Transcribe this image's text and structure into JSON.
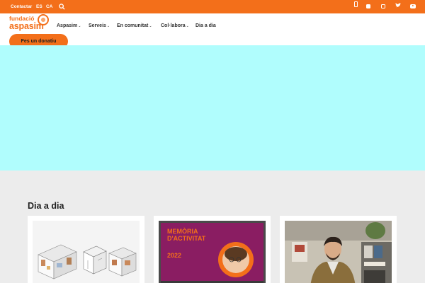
{
  "topbar": {
    "contact": "Contactar",
    "lang_es": "ES",
    "lang_ca": "CA",
    "search_icon": "search-icon",
    "social_icons": [
      "phone-icon",
      "facebook-icon",
      "instagram-icon",
      "twitter-icon",
      "youtube-icon"
    ],
    "color": "#f36f1a"
  },
  "logo": {
    "line1": "fundació",
    "line2": "aspasim"
  },
  "nav": {
    "items": [
      "Aspasim",
      "Serveis",
      "En comunitat",
      "Col·labora",
      "Dia a dia"
    ]
  },
  "donate_label": "Fes un donatiu",
  "hero": {
    "color": "#b0fdfd"
  },
  "section": {
    "title": "Dia a dia",
    "cards": [
      {
        "image": "isometric-room-diagrams-image"
      },
      {
        "image": "memoria-activitat-2022-cover-image",
        "cover_title": "MEMÒRIA D'ACTIVITAT",
        "cover_year": "2022"
      },
      {
        "image": "man-in-office-photo"
      }
    ]
  }
}
